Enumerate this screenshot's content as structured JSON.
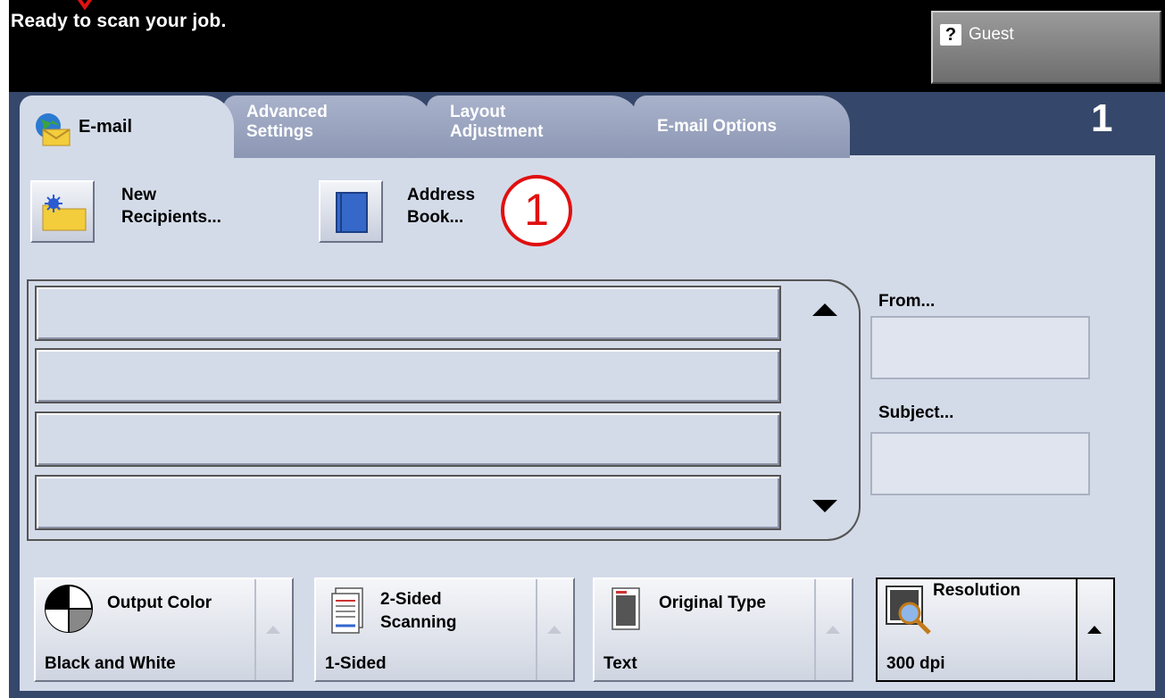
{
  "status": "Ready to scan your job.",
  "user": {
    "label": "Guest",
    "help_glyph": "?"
  },
  "tabs": [
    {
      "line1": "E-mail",
      "line2": ""
    },
    {
      "line1": "Advanced",
      "line2": "Settings"
    },
    {
      "line1": "Layout",
      "line2": "Adjustment"
    },
    {
      "line1": "E-mail Options",
      "line2": ""
    }
  ],
  "copy_count": "1",
  "buttons": {
    "new_recipients": {
      "line1": "New",
      "line2": "Recipients..."
    },
    "address_book": {
      "line1": "Address",
      "line2": "Book..."
    }
  },
  "callout": "1",
  "fields": {
    "from_label": "From...",
    "subject_label": "Subject..."
  },
  "features": [
    {
      "title1": "Output Color",
      "title2": "",
      "value": "Black and White"
    },
    {
      "title1": "2-Sided",
      "title2": "Scanning",
      "value": "1-Sided"
    },
    {
      "title1": "Original Type",
      "title2": "",
      "value": "Text"
    },
    {
      "title1": "Resolution",
      "title2": "",
      "value": "300 dpi"
    }
  ],
  "colors": {
    "header": "#000000",
    "tab_bar": "#35476a",
    "panel": "#d4dbe8",
    "callout": "#e01010"
  }
}
